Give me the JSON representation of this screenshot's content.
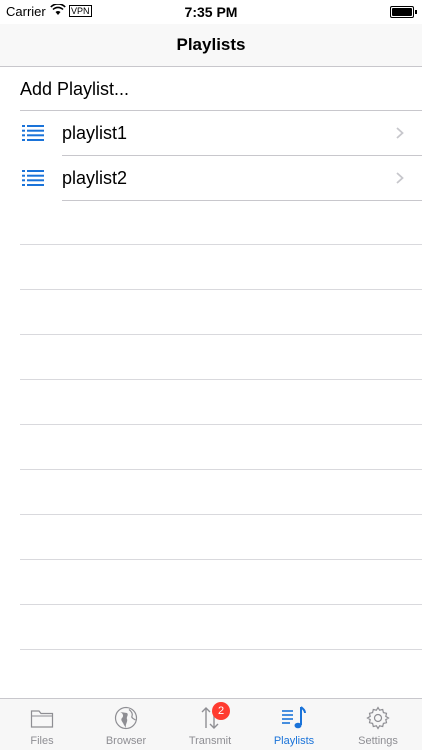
{
  "status_bar": {
    "carrier": "Carrier",
    "vpn": "VPN",
    "time": "7:35 PM"
  },
  "nav": {
    "title": "Playlists"
  },
  "list": {
    "add_label": "Add Playlist...",
    "items": [
      {
        "label": "playlist1",
        "icon": "list-icon"
      },
      {
        "label": "playlist2",
        "icon": "list-icon"
      }
    ]
  },
  "tab_bar": {
    "tabs": [
      {
        "label": "Files",
        "icon": "folder-icon"
      },
      {
        "label": "Browser",
        "icon": "globe-icon"
      },
      {
        "label": "Transmit",
        "icon": "transfer-icon",
        "badge": "2"
      },
      {
        "label": "Playlists",
        "icon": "playlist-icon",
        "active": true
      },
      {
        "label": "Settings",
        "icon": "gear-icon"
      }
    ]
  },
  "colors": {
    "accent": "#1a73d9",
    "badge": "#ff3b30",
    "inactive": "#8e8e93"
  }
}
